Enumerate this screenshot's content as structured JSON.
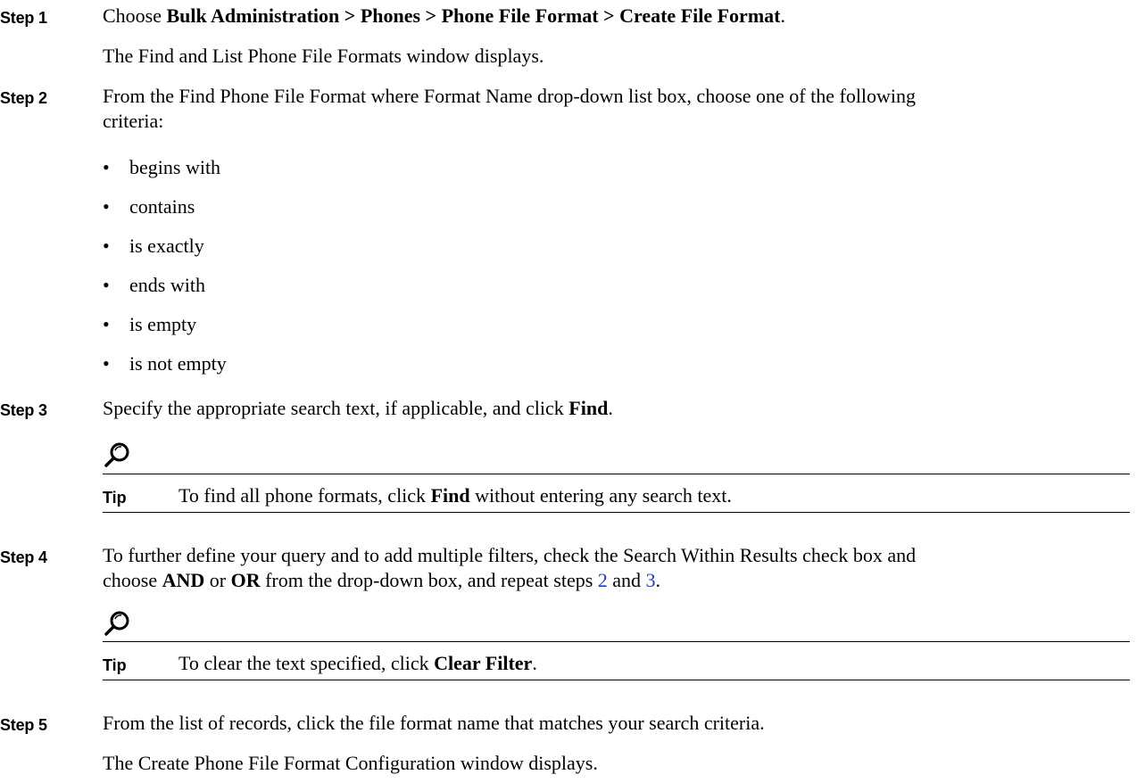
{
  "steps": [
    {
      "label": "Step 1",
      "line1": {
        "pre": "Choose ",
        "bold": "Bulk Administration > Phones > Phone File Format > Create File Format",
        "post": "."
      },
      "line2": "The Find and List Phone File Formats window displays."
    },
    {
      "label": "Step 2",
      "line1": "From the Find Phone File Format where Format Name drop-down list box, choose one of the following",
      "line2": "criteria:",
      "bullets": [
        "begins with",
        "contains",
        "is exactly",
        "ends with",
        "is empty",
        "is not empty"
      ]
    },
    {
      "label": "Step 3",
      "text": {
        "pre": "Specify the appropriate search text, if applicable, and click ",
        "bold": "Find",
        "post": "."
      },
      "tip": {
        "label": "Tip",
        "pre": "To find all phone formats, click ",
        "bold": "Find",
        "post": " without entering any search text."
      }
    },
    {
      "label": "Step 4",
      "line1": "To further define your query and to add multiple filters, check the Search Within Results check box and",
      "line2": {
        "pre": "choose ",
        "bold1": "AND",
        "mid": " or ",
        "bold2": "OR",
        "post": " from the drop-down box, and repeat steps ",
        "link1": "2",
        "and": " and ",
        "link2": "3",
        "end": "."
      },
      "tip": {
        "label": "Tip",
        "pre": "To clear the text specified, click ",
        "bold": "Clear Filter",
        "post": "."
      }
    },
    {
      "label": "Step 5",
      "line1": "From the list of records, click the file format name that matches your search criteria.",
      "line2": "The Create Phone File Format Configuration window displays."
    }
  ],
  "icons": {
    "tip": "magnifier-tip-icon"
  }
}
